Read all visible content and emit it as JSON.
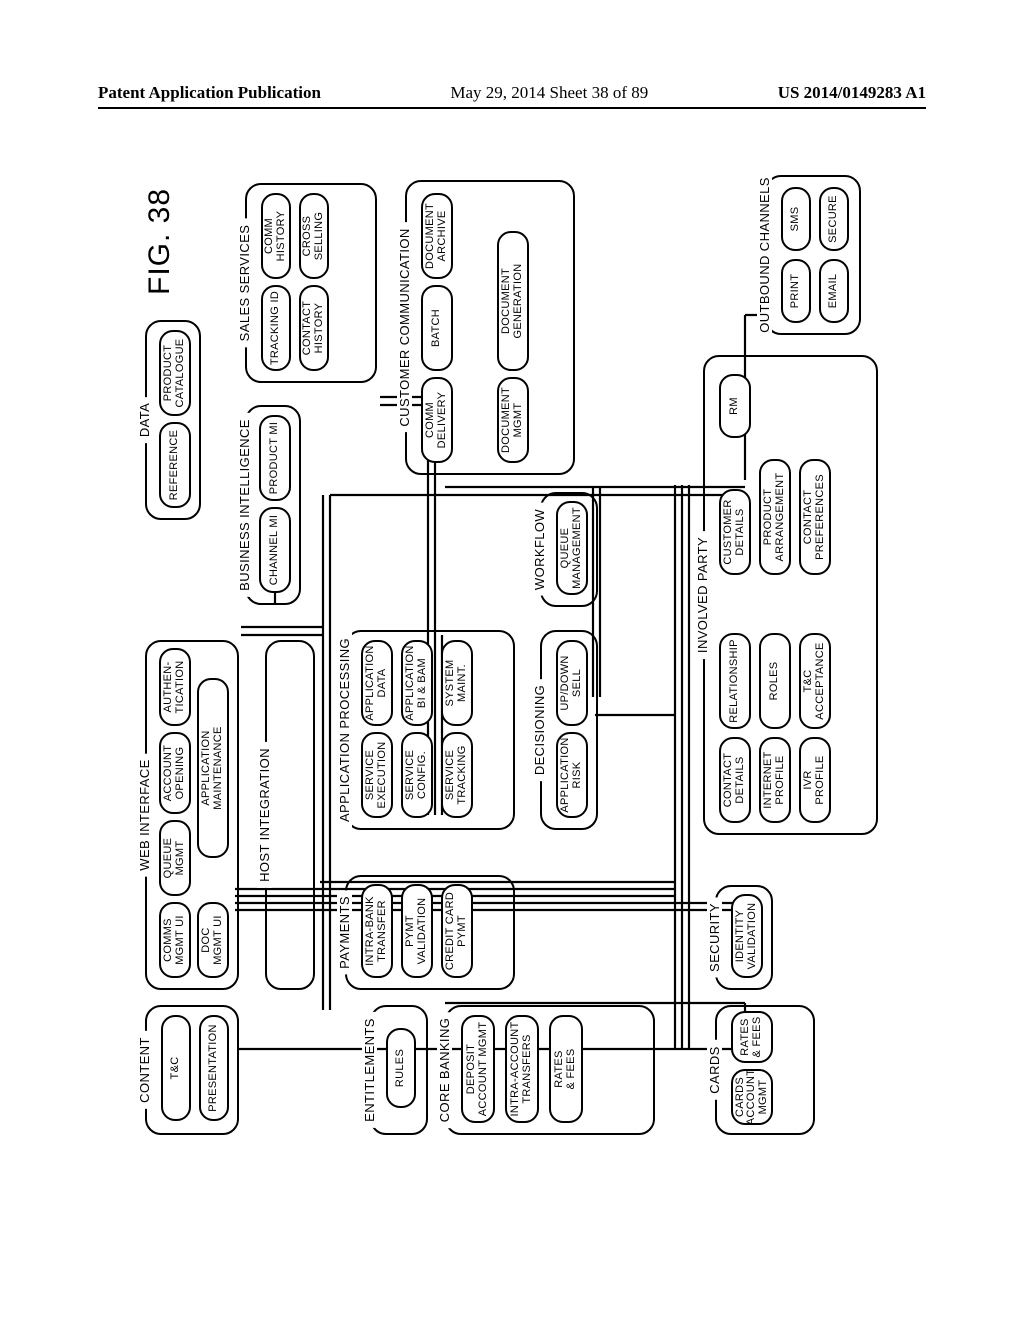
{
  "header": {
    "left": "Patent Application Publication",
    "center": "May 29, 2014  Sheet 38 of 89",
    "right": "US 2014/0149283 A1"
  },
  "figure": "FIG. 38",
  "groups": {
    "content": {
      "title": "CONTENT",
      "items": {
        "tc": "T&C",
        "presentation": "PRESENTATION"
      }
    },
    "web": {
      "title": "WEB INTERFACE",
      "items": {
        "comms": "COMMS\nMGMT UI",
        "queue": "QUEUE\nMGMT",
        "acct": "ACCOUNT\nOPENING",
        "auth": "AUTHEN-\nTICATION",
        "doc": "DOC\nMGMT UI",
        "appm": "APPLICATION\nMAINTENANCE"
      }
    },
    "data": {
      "title": "DATA",
      "items": {
        "ref": "REFERENCE",
        "prod": "PRODUCT\nCATALOGUE"
      }
    },
    "host": {
      "title": "HOST INTEGRATION"
    },
    "bi": {
      "title": "BUSINESS INTELLIGENCE",
      "items": {
        "ch": "CHANNEL MI",
        "pr": "PRODUCT MI"
      }
    },
    "sales": {
      "title": "SALES SERVICES",
      "items": {
        "track": "TRACKING ID",
        "commh": "COMM\nHISTORY",
        "contact": "CONTACT\nHISTORY",
        "cross": "CROSS\nSELLING"
      }
    },
    "entitle": {
      "title": "ENTITLEMENTS",
      "items": {
        "rules": "RULES"
      }
    },
    "payments": {
      "title": "PAYMENTS",
      "items": {
        "intra": "INTRA-BANK\nTRANSFER",
        "val": "PYMT\nVALIDATION",
        "cc": "CREDIT CARD\nPYMT"
      }
    },
    "appproc": {
      "title": "APPLICATION PROCESSING",
      "items": {
        "exec": "SERVICE\nEXECUTION",
        "appdata": "APPLICATION\nDATA",
        "config": "SERVICE\nCONFIG.",
        "bibam": "APPLICATION\nBI & BAM",
        "track": "SERVICE\nTRACKING",
        "maint": "SYSTEM\nMAINT."
      }
    },
    "custcomm": {
      "title": "CUSTOMER COMMUNICATION",
      "items": {
        "deliv": "COMM\nDELIVERY",
        "batch": "BATCH",
        "arch": "DOCUMENT\nARCHIVE",
        "mgmt": "DOCUMENT\nMGMT",
        "gen": "DOCUMENT\nGENERATION"
      }
    },
    "core": {
      "title": "CORE BANKING",
      "items": {
        "deposit": "DEPOSIT\nACCOUNT MGMT",
        "intra": "INTRA-ACCOUNT\nTRANSFERS",
        "rates": "RATES\n& FEES"
      }
    },
    "decision": {
      "title": "DECISIONING",
      "items": {
        "risk": "APPLICATION\nRISK",
        "updown": "UP/DOWN\nSELL"
      }
    },
    "workflow": {
      "title": "WORKFLOW",
      "items": {
        "queue": "QUEUE\nMANAGEMENT"
      }
    },
    "cards": {
      "title": "CARDS",
      "items": {
        "acct": "CARDS\nACCOUNT\nMGMT",
        "rates": "RATES\n& FEES"
      }
    },
    "security": {
      "title": "SECURITY",
      "items": {
        "idval": "IDENTITY\nVALIDATION"
      }
    },
    "party": {
      "title": "INVOLVED PARTY",
      "items": {
        "contact": "CONTACT\nDETAILS",
        "rel": "RELATIONSHIP",
        "cust": "CUSTOMER\nDETAILS",
        "rm": "RM",
        "inet": "INTERNET\nPROFILE",
        "roles": "ROLES",
        "prod": "PRODUCT\nARRANGEMENT",
        "ivr": "IVR\nPROFILE",
        "tcacc": "T&C\nACCEPTANCE",
        "pref": "CONTACT\nPREFERENCES"
      }
    },
    "outbound": {
      "title": "OUTBOUND CHANNELS",
      "items": {
        "print": "PRINT",
        "sms": "SMS",
        "email": "EMAIL",
        "secure": "SECURE"
      }
    }
  }
}
